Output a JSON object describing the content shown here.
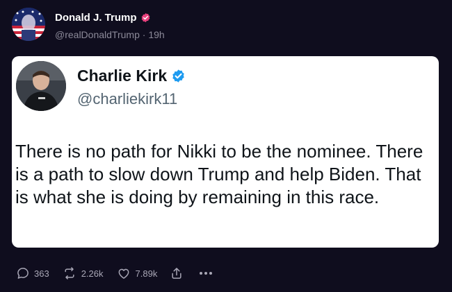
{
  "post": {
    "author_name": "Donald J. Trump",
    "handle": "@realDonaldTrump",
    "separator": "·",
    "time": "19h"
  },
  "embed": {
    "name": "Charlie Kirk",
    "handle": "@charliekirk11",
    "text": "There is no path for Nikki to be the nominee. There is a path to slow down Trump and help Biden. That is what she is doing by remaining in this race."
  },
  "actions": {
    "replies": "363",
    "reposts": "2.26k",
    "likes": "7.89k"
  },
  "colors": {
    "background": "#0f0d1e",
    "verified_pink": "#e8417d",
    "verified_blue": "#1d9bf0",
    "muted": "#8c8a99"
  },
  "icons": [
    "avatar-flag",
    "verified-badge",
    "reply-icon",
    "repost-icon",
    "like-icon",
    "share-icon",
    "more-icon"
  ]
}
